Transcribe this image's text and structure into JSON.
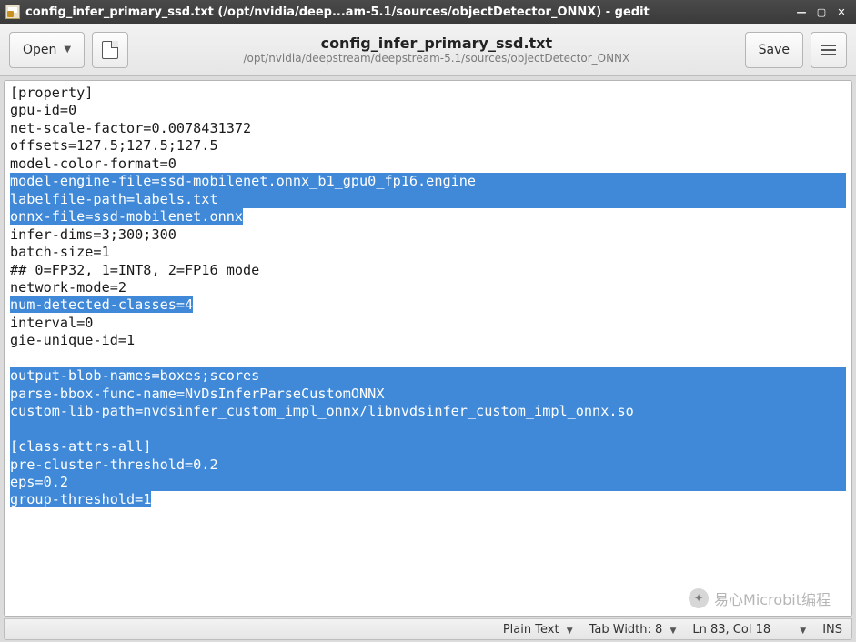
{
  "window": {
    "title": "config_infer_primary_ssd.txt (/opt/nvidia/deep...am-5.1/sources/objectDetector_ONNX) - gedit"
  },
  "toolbar": {
    "open_label": "Open",
    "save_label": "Save",
    "filename": "config_infer_primary_ssd.txt",
    "filepath": "/opt/nvidia/deepstream/deepstream-5.1/sources/objectDetector_ONNX"
  },
  "editor": {
    "lines": [
      {
        "text": "[property]",
        "sel": false
      },
      {
        "text": "gpu-id=0",
        "sel": false
      },
      {
        "text": "net-scale-factor=0.0078431372",
        "sel": false
      },
      {
        "text": "offsets=127.5;127.5;127.5",
        "sel": false
      },
      {
        "text": "model-color-format=0",
        "sel": false
      },
      {
        "text": "model-engine-file=ssd-mobilenet.onnx_b1_gpu0_fp16.engine",
        "sel": true,
        "full": true
      },
      {
        "text": "labelfile-path=labels.txt",
        "sel": true,
        "full": true
      },
      {
        "text": "onnx-file=ssd-mobilenet.onnx",
        "sel": true,
        "full": false
      },
      {
        "text": "infer-dims=3;300;300",
        "sel": false
      },
      {
        "text": "batch-size=1",
        "sel": false
      },
      {
        "text": "## 0=FP32, 1=INT8, 2=FP16 mode",
        "sel": false
      },
      {
        "text": "network-mode=2",
        "sel": false
      },
      {
        "text": "num-detected-classes=4",
        "sel": true,
        "full": false
      },
      {
        "text": "interval=0",
        "sel": false
      },
      {
        "text": "gie-unique-id=1",
        "sel": false
      },
      {
        "text": "",
        "sel": false
      },
      {
        "text": "output-blob-names=boxes;scores",
        "sel": true,
        "full": true
      },
      {
        "text": "parse-bbox-func-name=NvDsInferParseCustomONNX",
        "sel": true,
        "full": true
      },
      {
        "text": "custom-lib-path=nvdsinfer_custom_impl_onnx/libnvdsinfer_custom_impl_onnx.so",
        "sel": true,
        "full": true
      },
      {
        "text": "",
        "sel": true,
        "full": true
      },
      {
        "text": "[class-attrs-all]",
        "sel": true,
        "full": true
      },
      {
        "text": "pre-cluster-threshold=0.2",
        "sel": true,
        "full": true
      },
      {
        "text": "eps=0.2",
        "sel": true,
        "full": true
      },
      {
        "text": "group-threshold=1",
        "sel": true,
        "full": false
      }
    ]
  },
  "statusbar": {
    "syntax": "Plain Text",
    "tabwidth_label": "Tab Width: 8",
    "position": "Ln 83, Col 18",
    "insert_mode": "INS"
  },
  "watermark": {
    "text": "易心Microbit编程"
  }
}
